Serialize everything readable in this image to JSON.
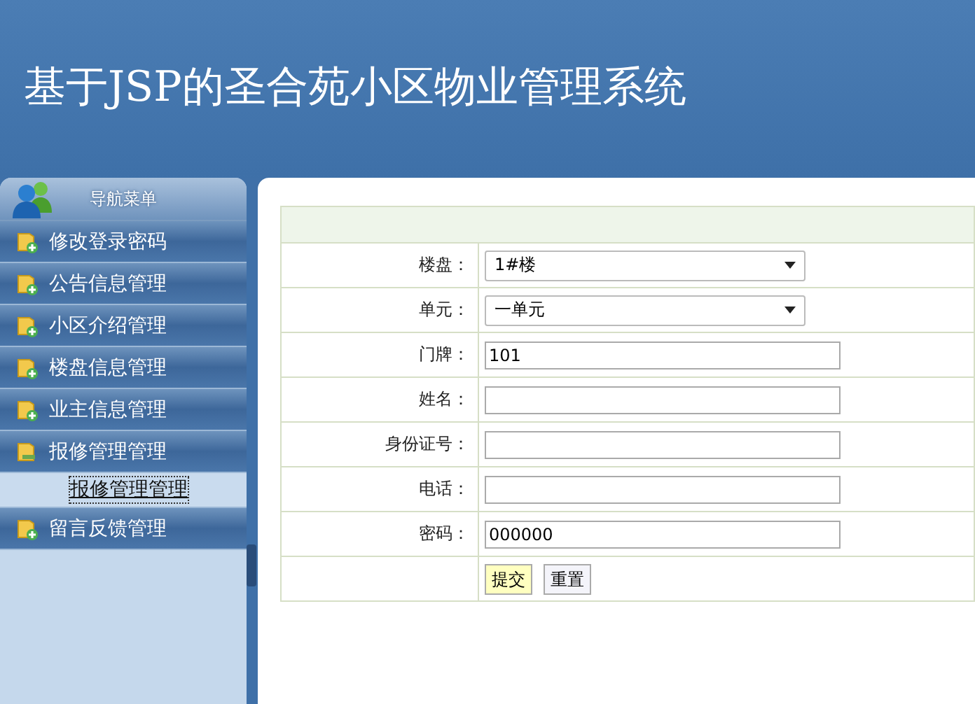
{
  "header": {
    "title": "基于JSP的圣合苑小区物业管理系统"
  },
  "sidebar": {
    "header": "导航菜单",
    "items": [
      {
        "label": "修改登录密码",
        "expanded": false
      },
      {
        "label": "公告信息管理",
        "expanded": false
      },
      {
        "label": "小区介绍管理",
        "expanded": false
      },
      {
        "label": "楼盘信息管理",
        "expanded": false
      },
      {
        "label": "业主信息管理",
        "expanded": false
      },
      {
        "label": "报修管理管理",
        "expanded": true,
        "children": [
          {
            "label": "报修管理管理",
            "selected": true
          }
        ]
      },
      {
        "label": "留言反馈管理",
        "expanded": false
      }
    ]
  },
  "form": {
    "fields": [
      {
        "label": "楼盘：",
        "kind": "select",
        "value": "1#楼"
      },
      {
        "label": "单元：",
        "kind": "select",
        "value": "一单元"
      },
      {
        "label": "门牌：",
        "kind": "text",
        "value": "101"
      },
      {
        "label": "姓名：",
        "kind": "text"
      },
      {
        "label": "身份证号：",
        "kind": "text"
      },
      {
        "label": "电话：",
        "kind": "text"
      },
      {
        "label": "密码：",
        "kind": "text",
        "value": "000000"
      }
    ],
    "buttons": [
      {
        "label": "提交",
        "kind": "submit"
      },
      {
        "label": "重置",
        "kind": "reset"
      }
    ]
  }
}
